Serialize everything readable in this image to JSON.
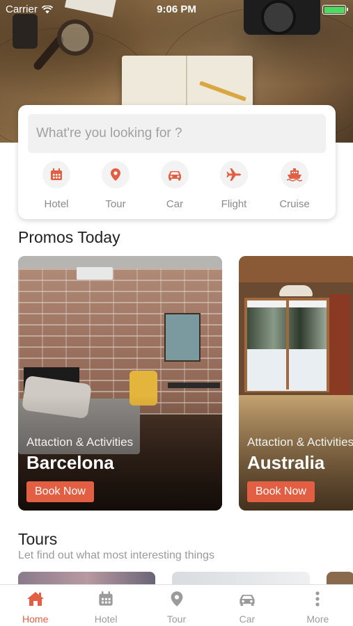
{
  "status_bar": {
    "carrier": "Carrier",
    "time": "9:06 PM",
    "battery_level": 1.0
  },
  "search": {
    "placeholder": "What're you looking for ?"
  },
  "categories": [
    {
      "label": "Hotel",
      "icon": "calendar-icon"
    },
    {
      "label": "Tour",
      "icon": "map-pin-icon"
    },
    {
      "label": "Car",
      "icon": "car-icon"
    },
    {
      "label": "Flight",
      "icon": "airplane-icon"
    },
    {
      "label": "Cruise",
      "icon": "ship-icon"
    }
  ],
  "promos": {
    "title": "Promos Today",
    "items": [
      {
        "tag": "Attaction & Activities",
        "city": "Barcelona",
        "button": "Book Now"
      },
      {
        "tag": "Attaction & Activities",
        "city": "Australia",
        "button": "Book Now"
      }
    ]
  },
  "tours": {
    "title": "Tours",
    "subtitle": "Let find out what most interesting things"
  },
  "tabbar": {
    "active": "Home",
    "items": [
      {
        "label": "Home",
        "icon": "home-icon"
      },
      {
        "label": "Hotel",
        "icon": "calendar-icon"
      },
      {
        "label": "Tour",
        "icon": "map-pin-icon"
      },
      {
        "label": "Car",
        "icon": "car-icon"
      },
      {
        "label": "More",
        "icon": "more-icon"
      }
    ]
  },
  "colors": {
    "accent": "#e25f44",
    "muted": "#9b9b9b"
  }
}
